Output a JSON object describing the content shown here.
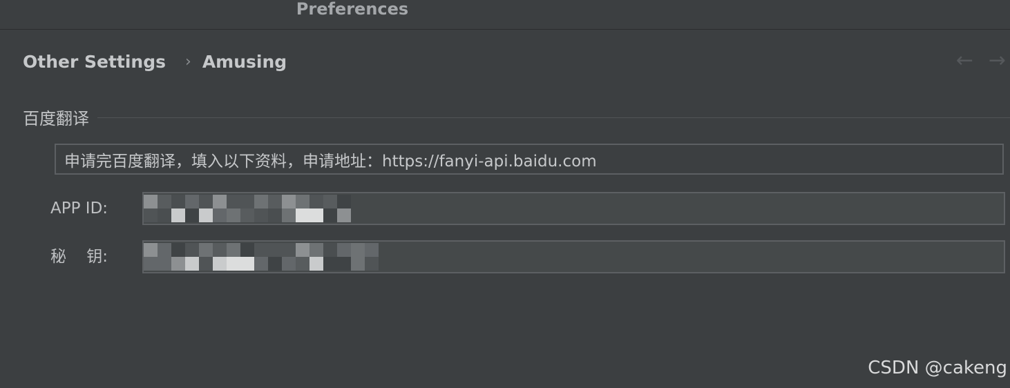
{
  "window": {
    "title": "Preferences"
  },
  "breadcrumb": {
    "parent": "Other Settings",
    "separator": "›",
    "current": "Amusing"
  },
  "nav": {
    "back_icon": "arrow-left-icon",
    "forward_icon": "arrow-right-icon",
    "back_glyph": "←",
    "forward_glyph": "→"
  },
  "section": {
    "title": "百度翻译"
  },
  "info": {
    "text": "申请完百度翻译，填入以下资料，申请地址：https://fanyi-api.baidu.com"
  },
  "fields": {
    "app_id_label": "APP ID:",
    "secret_label": "秘    钥:"
  },
  "watermark": {
    "text": "CSDN @cakeng"
  },
  "colors": {
    "background": "#3c3f41",
    "input_background": "#45494a",
    "border": "#5d6063",
    "text": "#bbbbbb"
  }
}
